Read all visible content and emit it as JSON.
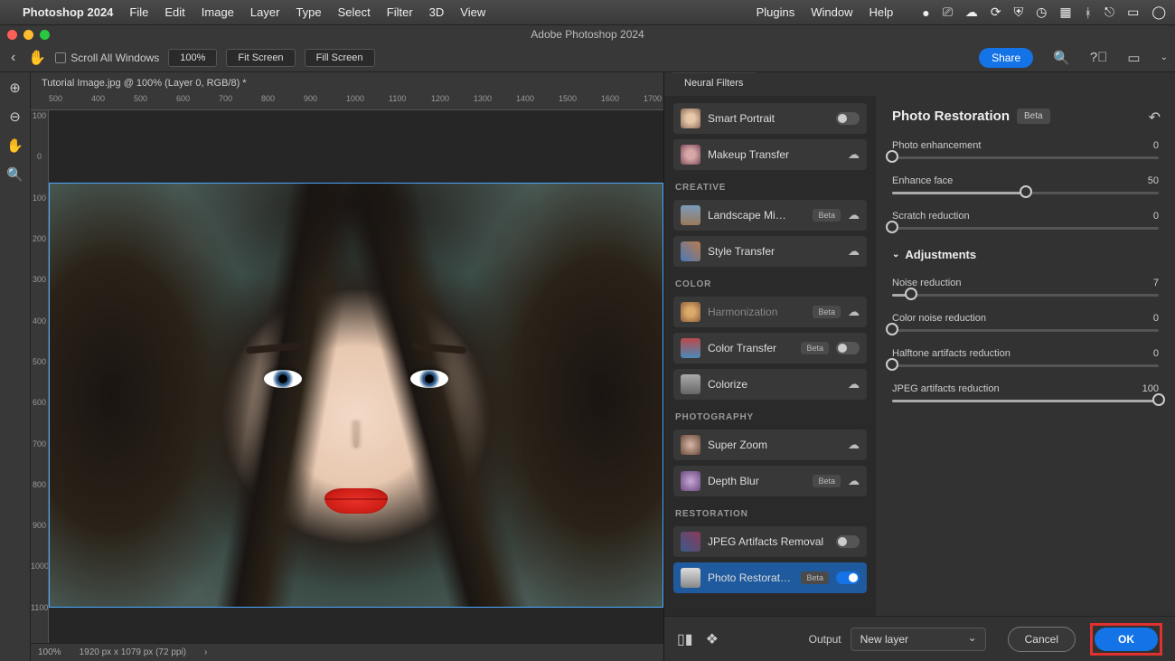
{
  "menubar": {
    "appname": "Photoshop 2024",
    "items": [
      "File",
      "Edit",
      "Image",
      "Layer",
      "Type",
      "Select",
      "Filter",
      "3D",
      "View"
    ],
    "right": [
      "Plugins",
      "Window",
      "Help"
    ]
  },
  "window": {
    "title": "Adobe Photoshop 2024"
  },
  "optbar": {
    "scroll_all": "Scroll All Windows",
    "zoom": "100%",
    "fit": "Fit Screen",
    "fill": "Fill Screen",
    "share": "Share"
  },
  "doc": {
    "tab": "Tutorial Image.jpg @ 100% (Layer 0, RGB/8) *",
    "status_zoom": "100%",
    "status_dims": "1920 px x 1079 px (72 ppi)"
  },
  "ruler_h": [
    "500",
    "400",
    "500",
    "600",
    "700",
    "800",
    "900",
    "1000",
    "1100",
    "1200",
    "1300",
    "1400",
    "1500",
    "1600",
    "1700"
  ],
  "ruler_v": [
    "100",
    "0",
    "100",
    "200",
    "300",
    "400",
    "500",
    "600",
    "700",
    "800",
    "900",
    "1000",
    "1100"
  ],
  "nf": {
    "tab": "Neural Filters",
    "filters": [
      {
        "name": "Smart Portrait",
        "thumb": "th-face",
        "ctrl": "toggle",
        "on": false
      },
      {
        "name": "Makeup Transfer",
        "thumb": "th-makeup",
        "ctrl": "cloud"
      }
    ],
    "cats": [
      {
        "label": "CREATIVE",
        "items": [
          {
            "name": "Landscape Mi…",
            "thumb": "th-land",
            "beta": true,
            "ctrl": "cloud"
          },
          {
            "name": "Style Transfer",
            "thumb": "th-style",
            "ctrl": "cloud"
          }
        ]
      },
      {
        "label": "COLOR",
        "items": [
          {
            "name": "Harmonization",
            "thumb": "th-harm",
            "beta": true,
            "ctrl": "cloud",
            "dim": true
          },
          {
            "name": "Color Transfer",
            "thumb": "th-ctrans",
            "beta": true,
            "ctrl": "toggle",
            "on": false
          },
          {
            "name": "Colorize",
            "thumb": "th-colorize",
            "ctrl": "cloud"
          }
        ]
      },
      {
        "label": "PHOTOGRAPHY",
        "items": [
          {
            "name": "Super Zoom",
            "thumb": "th-zoom",
            "ctrl": "cloud"
          },
          {
            "name": "Depth Blur",
            "thumb": "th-depth",
            "beta": true,
            "ctrl": "cloud"
          }
        ]
      },
      {
        "label": "RESTORATION",
        "items": [
          {
            "name": "JPEG Artifacts Removal",
            "thumb": "th-jpeg",
            "ctrl": "toggle",
            "on": false
          },
          {
            "name": "Photo Restorat…",
            "thumb": "th-restore",
            "beta": true,
            "ctrl": "toggle",
            "on": true,
            "sel": true
          }
        ]
      }
    ]
  },
  "panel": {
    "title": "Photo Restoration",
    "beta": "Beta",
    "adjustments": "Adjustments",
    "sliders": [
      {
        "label": "Photo enhancement",
        "value": 0,
        "pct": 0
      },
      {
        "label": "Enhance face",
        "value": 50,
        "pct": 50
      },
      {
        "label": "Scratch reduction",
        "value": 0,
        "pct": 0
      }
    ],
    "adj_sliders": [
      {
        "label": "Noise reduction",
        "value": 7,
        "pct": 7
      },
      {
        "label": "Color noise reduction",
        "value": 0,
        "pct": 0
      },
      {
        "label": "Halftone artifacts reduction",
        "value": 0,
        "pct": 0
      },
      {
        "label": "JPEG artifacts reduction",
        "value": 100,
        "pct": 100
      }
    ]
  },
  "footer": {
    "output": "Output",
    "output_value": "New layer",
    "cancel": "Cancel",
    "ok": "OK"
  }
}
